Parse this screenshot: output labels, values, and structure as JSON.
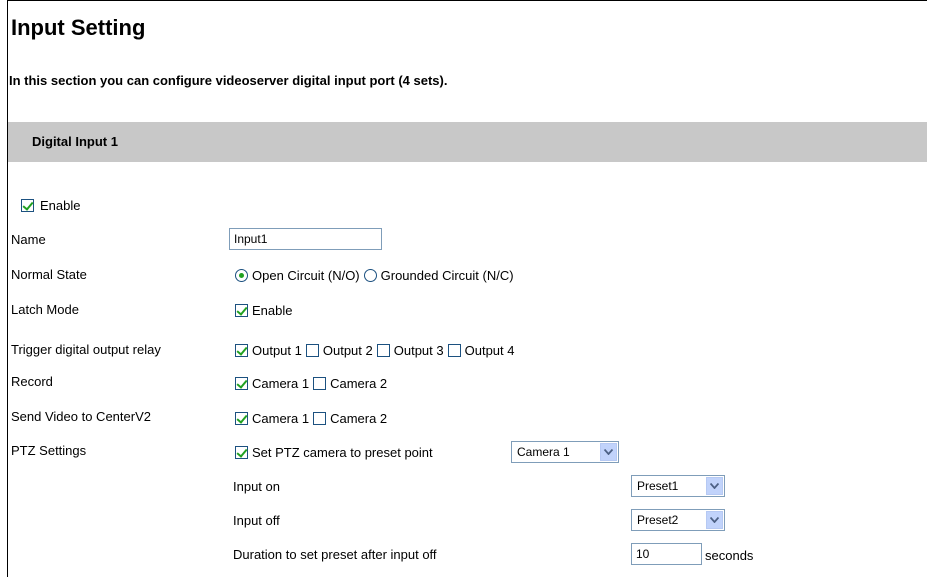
{
  "page": {
    "title": "Input Setting",
    "description": "In this section you can configure videoserver digital input port (4 sets)."
  },
  "section": {
    "title": "Digital Input 1"
  },
  "enable": {
    "label": "Enable",
    "checked": true
  },
  "name": {
    "label": "Name",
    "value": "Input1"
  },
  "normal_state": {
    "label": "Normal State",
    "options": [
      {
        "label": "Open Circuit (N/O)",
        "selected": true
      },
      {
        "label": "Grounded Circuit (N/C)",
        "selected": false
      }
    ]
  },
  "latch_mode": {
    "label": "Latch Mode",
    "option_label": "Enable",
    "checked": true
  },
  "trigger_relay": {
    "label": "Trigger digital output relay",
    "options": [
      {
        "label": "Output 1",
        "checked": true
      },
      {
        "label": "Output 2",
        "checked": false
      },
      {
        "label": "Output 3",
        "checked": false
      },
      {
        "label": "Output 4",
        "checked": false
      }
    ]
  },
  "record": {
    "label": "Record",
    "options": [
      {
        "label": "Camera 1",
        "checked": true
      },
      {
        "label": "Camera 2",
        "checked": false
      }
    ]
  },
  "send_video": {
    "label": "Send Video to CenterV2",
    "options": [
      {
        "label": "Camera 1",
        "checked": true
      },
      {
        "label": "Camera 2",
        "checked": false
      }
    ]
  },
  "ptz": {
    "label": "PTZ Settings",
    "option_label": "Set PTZ camera to preset point",
    "checked": true,
    "camera_select": "Camera 1",
    "input_on_label": "Input on",
    "input_on_value": "Preset1",
    "input_off_label": "Input off",
    "input_off_value": "Preset2",
    "duration_label": "Duration to set preset after input off",
    "duration_value": "10",
    "duration_unit": "seconds"
  },
  "colors": {
    "section_bar": "#c8c8c8",
    "check_mark": "#21a121",
    "control_border": "#1c5180",
    "select_arrow_bg": "#c1d3fb"
  }
}
